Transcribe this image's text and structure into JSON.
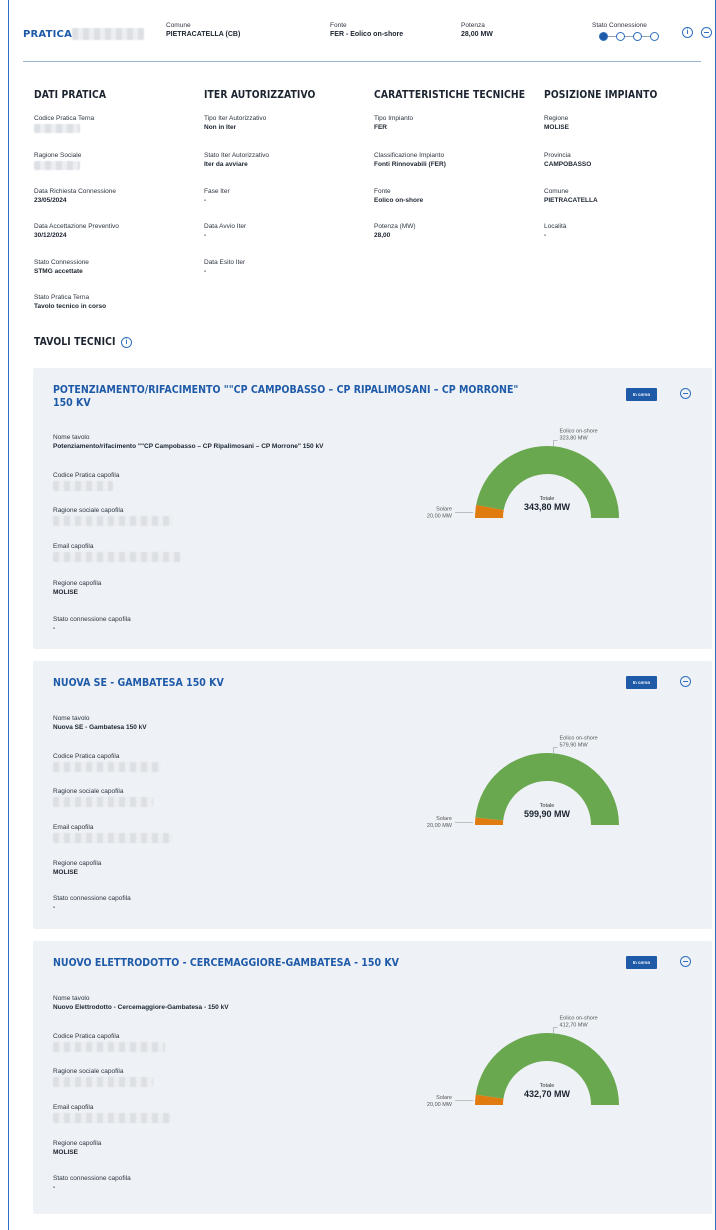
{
  "header": {
    "title": "PRATICA",
    "comune_label": "Comune",
    "comune_value": "PIETRACATELLA (CB)",
    "fonte_label": "Fonte",
    "fonte_value": "FER - Eolico on-shore",
    "potenza_label": "Potenza",
    "potenza_value": "28,00 MW",
    "stato_label": "Stato Connessione",
    "stato_step_active": 1,
    "stato_steps_total": 4
  },
  "dati_pratica": {
    "title": "DATI PRATICA",
    "codice_label": "Codice Pratica Terna",
    "ragione_label": "Ragione Sociale",
    "data_richiesta_label": "Data Richiesta Connessione",
    "data_richiesta_value": "23/05/2024",
    "data_accettazione_label": "Data Accettazione Preventivo",
    "data_accettazione_value": "30/12/2024",
    "stato_connessione_label": "Stato Connessione",
    "stato_connessione_value": "STMG accettate",
    "stato_pratica_label": "Stato Pratica Terna",
    "stato_pratica_value": "Tavolo tecnico in corso"
  },
  "iter": {
    "title": "ITER AUTORIZZATIVO",
    "tipo_label": "Tipo Iter Autorizzativo",
    "tipo_value": "Non in Iter",
    "stato_label": "Stato Iter Autorizzativo",
    "stato_value": "Iter da avviare",
    "fase_label": "Fase Iter",
    "fase_value": "-",
    "avvio_label": "Data Avvio Iter",
    "avvio_value": "-",
    "esito_label": "Data Esito Iter",
    "esito_value": "-"
  },
  "caratteristiche": {
    "title": "CARATTERISTICHE TECNICHE",
    "tipo_label": "Tipo Impianto",
    "tipo_value": "FER",
    "class_label": "Classificazione Impianto",
    "class_value": "Fonti Rinnovabili (FER)",
    "fonte_label": "Fonte",
    "fonte_value": "Eolico on-shore",
    "potenza_label": "Potenza (MW)",
    "potenza_value": "28,00"
  },
  "posizione": {
    "title": "POSIZIONE IMPIANTO",
    "regione_label": "Regione",
    "regione_value": "MOLISE",
    "provincia_label": "Provincia",
    "provincia_value": "CAMPOBASSO",
    "comune_label": "Comune",
    "comune_value": "PIETRACATELLA",
    "localita_label": "Località",
    "localita_value": "-"
  },
  "tavoli_title": "TAVOLI TECNICI",
  "tavoli": [
    {
      "title_line1": "POTENZIAMENTO/RIFACIMENTO \"\"CP CAMPOBASSO – CP RIPALIMOSANI – CP MORRONE\"",
      "title_line2": "150 KV",
      "status": "In corso",
      "nome_label": "Nome tavolo",
      "nome_value": "Potenziamento/rifacimento \"\"CP Campobasso – CP Ripalimosani – CP Morrone\" 150 kV",
      "codice_label": "Codice Pratica capofila",
      "ragione_label": "Ragione sociale capofila",
      "email_label": "Email capofila",
      "regione_label": "Regione capofila",
      "regione_value": "MOLISE",
      "stato_label": "Stato connessione capofila",
      "stato_value": "-",
      "chart_data": {
        "type": "pie",
        "series": [
          {
            "name": "Eolico on-shore",
            "label": "323,80 MW",
            "value": 323.8,
            "color": "#6aa84f"
          },
          {
            "name": "Solare",
            "label": "20,00 MW",
            "value": 20.0,
            "color": "#e07b10"
          }
        ],
        "total_label": "Totale",
        "total_value": "343,80 MW"
      }
    },
    {
      "title_line1": "NUOVA SE - GAMBATESA 150 KV",
      "title_line2": "",
      "status": "In corso",
      "nome_label": "Nome tavolo",
      "nome_value": "Nuova SE - Gambatesa 150 kV",
      "codice_label": "Codice Pratica capofila",
      "ragione_label": "Ragione sociale capofila",
      "email_label": "Email capofila",
      "regione_label": "Regione capofila",
      "regione_value": "MOLISE",
      "stato_label": "Stato connessione capofila",
      "stato_value": "-",
      "chart_data": {
        "type": "pie",
        "series": [
          {
            "name": "Eolico on-shore",
            "label": "579,90 MW",
            "value": 579.9,
            "color": "#6aa84f"
          },
          {
            "name": "Solare",
            "label": "20,00 MW",
            "value": 20.0,
            "color": "#e07b10"
          }
        ],
        "total_label": "Totale",
        "total_value": "599,90 MW"
      }
    },
    {
      "title_line1": "NUOVO ELETTRODOTTO - CERCEMAGGIORE-GAMBATESA - 150 KV",
      "title_line2": "",
      "status": "In corso",
      "nome_label": "Nome tavolo",
      "nome_value": "Nuovo Elettrodotto - Cercemaggiore-Gambatesa - 150 kV",
      "codice_label": "Codice Pratica capofila",
      "ragione_label": "Ragione sociale capofila",
      "email_label": "Email capofila",
      "regione_label": "Regione capofila",
      "regione_value": "MOLISE",
      "stato_label": "Stato connessione capofila",
      "stato_value": "-",
      "chart_data": {
        "type": "pie",
        "series": [
          {
            "name": "Eolico on-shore",
            "label": "412,70 MW",
            "value": 412.7,
            "color": "#6aa84f"
          },
          {
            "name": "Solare",
            "label": "20,00 MW",
            "value": 20.0,
            "color": "#e07b10"
          }
        ],
        "total_label": "Totale",
        "total_value": "432,70 MW"
      }
    }
  ],
  "colors": {
    "accent": "#1f5aa8",
    "card_bg": "#eef2f7",
    "eolico": "#6aa84f",
    "solare": "#e07b10"
  },
  "icons": [
    "info-icon",
    "collapse-icon"
  ]
}
